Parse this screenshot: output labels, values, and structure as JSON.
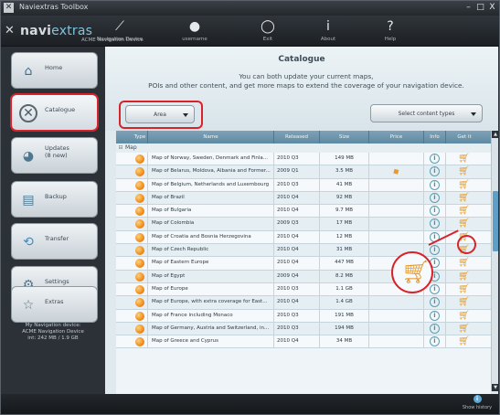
{
  "window": {
    "title": "Naviextras Toolbox",
    "controls": [
      "–",
      "□",
      "X"
    ]
  },
  "topnav": {
    "device_label": "ACME Navigation Device",
    "items": [
      {
        "label": "Navigation Device",
        "icon": "satellite-icon"
      },
      {
        "label": "username",
        "icon": "user-icon"
      },
      {
        "label": "Exit",
        "icon": "power-icon"
      },
      {
        "label": "About",
        "icon": "info-icon"
      },
      {
        "label": "Help",
        "icon": "help-icon"
      }
    ]
  },
  "logo": {
    "text": "naviextras"
  },
  "sidebar": {
    "items": [
      {
        "label": "Home",
        "icon": "home-icon"
      },
      {
        "label": "Catalogue",
        "icon": "catalogue-icon"
      },
      {
        "label": "Updates",
        "sublabel": "(8 new)",
        "icon": "updates-icon"
      },
      {
        "label": "Backup",
        "icon": "backup-icon"
      },
      {
        "label": "Transfer",
        "icon": "transfer-icon"
      },
      {
        "label": "Settings",
        "icon": "settings-icon"
      },
      {
        "label": "Extras",
        "icon": "extras-icon"
      }
    ],
    "device_info": [
      "My Navigation device:",
      "ACME Navigation Device",
      "int: 242 MB / 1.9 GB"
    ]
  },
  "catalogue": {
    "heading": "Catalogue",
    "description_line1": "You can both update your current maps,",
    "description_line2": "POIs and other content, and get more maps to extend the coverage of your navigation device.",
    "area_dropdown": "Area",
    "content_types_dropdown": "Select content types",
    "columns": [
      "Type",
      "Name",
      "Released",
      "Size",
      "Price",
      "Info",
      "Get it"
    ],
    "group": "Map",
    "rows": [
      {
        "name": "Map of Norway, Sweden, Denmark and Finla...",
        "released": "2010 Q3",
        "size": "149 MB"
      },
      {
        "name": "Map of Belarus, Moldova, Albania and Former...",
        "released": "2009 Q1",
        "size": "3.5 MB",
        "price_icon": "price-tag-icon"
      },
      {
        "name": "Map of Belgium, Netherlands and Luxembourg",
        "released": "2010 Q3",
        "size": "41 MB"
      },
      {
        "name": "Map of Brazil",
        "released": "2010 Q4",
        "size": "92 MB"
      },
      {
        "name": "Map of Bulgaria",
        "released": "2010 Q4",
        "size": "9.7 MB"
      },
      {
        "name": "Map of Colombia",
        "released": "2009 Q3",
        "size": "17 MB"
      },
      {
        "name": "Map of Croatia and Bosnia Herzegovina",
        "released": "2010 Q4",
        "size": "12 MB"
      },
      {
        "name": "Map of Czech Republic",
        "released": "2010 Q4",
        "size": "31 MB"
      },
      {
        "name": "Map of Eastern Europe",
        "released": "2010 Q4",
        "size": "447 MB"
      },
      {
        "name": "Map of Egypt",
        "released": "2009 Q4",
        "size": "8.2 MB"
      },
      {
        "name": "Map of Europe",
        "released": "2010 Q3",
        "size": "1.1 GB"
      },
      {
        "name": "Map of Europe, with extra coverage for East...",
        "released": "2010 Q4",
        "size": "1.4 GB"
      },
      {
        "name": "Map of France including Monaco",
        "released": "2010 Q3",
        "size": "191 MB"
      },
      {
        "name": "Map of Germany, Austria and Switzerland, in...",
        "released": "2010 Q3",
        "size": "194 MB"
      },
      {
        "name": "Map of Greece and Cyprus",
        "released": "2010 Q4",
        "size": "34 MB"
      }
    ]
  },
  "bottombar": {
    "history_label": "Show history"
  },
  "colors": {
    "accent": "#5fa8d3",
    "highlight": "#d8232a",
    "cart": "#e69a2a",
    "dark": "#2b3136"
  }
}
